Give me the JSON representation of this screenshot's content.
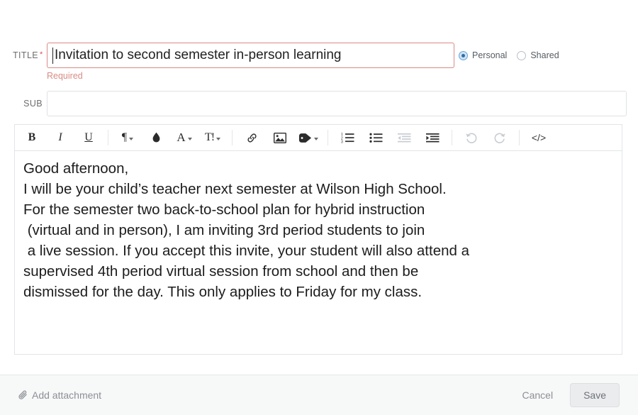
{
  "form": {
    "title_field": {
      "label": "TITLE",
      "required_marker": "*",
      "value": "Invitation to second semester in-person learning",
      "placeholder": "",
      "error": "Required"
    },
    "sub_field": {
      "label": "SUB",
      "value": "",
      "placeholder": ""
    },
    "visibility": {
      "options": [
        {
          "label": "Personal",
          "selected": true
        },
        {
          "label": "Shared",
          "selected": false
        }
      ]
    }
  },
  "editor": {
    "toolbar": [
      {
        "name": "bold",
        "glyph": "B"
      },
      {
        "name": "italic",
        "glyph": "I"
      },
      {
        "name": "underline",
        "glyph": "U"
      },
      {
        "name": "paragraph-format",
        "glyph": "¶"
      },
      {
        "name": "highlight-color",
        "glyph": "◆"
      },
      {
        "name": "text-color",
        "glyph": "A"
      },
      {
        "name": "font-size",
        "glyph": "T!"
      },
      {
        "name": "insert-link",
        "glyph": "link"
      },
      {
        "name": "insert-image",
        "glyph": "image"
      },
      {
        "name": "insert-tag",
        "glyph": "tag"
      },
      {
        "name": "numbered-list",
        "glyph": "list-ol"
      },
      {
        "name": "bullet-list",
        "glyph": "list-ul"
      },
      {
        "name": "outdent",
        "glyph": "outdent"
      },
      {
        "name": "indent",
        "glyph": "indent"
      },
      {
        "name": "undo",
        "glyph": "undo"
      },
      {
        "name": "redo",
        "glyph": "redo"
      },
      {
        "name": "code-view",
        "glyph": "</>"
      }
    ],
    "content": "Good afternoon,\nI will be your child’s teacher next semester at Wilson High School.\nFor the semester two back-to-school plan for hybrid instruction\n (virtual and in person), I am inviting 3rd period students to join\n a live session. If you accept this invite, your student will also attend a\nsupervised 4th period virtual session from school and then be\ndismissed for the day. This only applies to Friday for my class."
  },
  "footer": {
    "add_attachment_label": "Add attachment",
    "cancel_label": "Cancel",
    "save_label": "Save"
  },
  "colors": {
    "error": "#d98b86",
    "radio_accent": "#2f6fa8",
    "footer_bg": "#f7f8f8"
  }
}
